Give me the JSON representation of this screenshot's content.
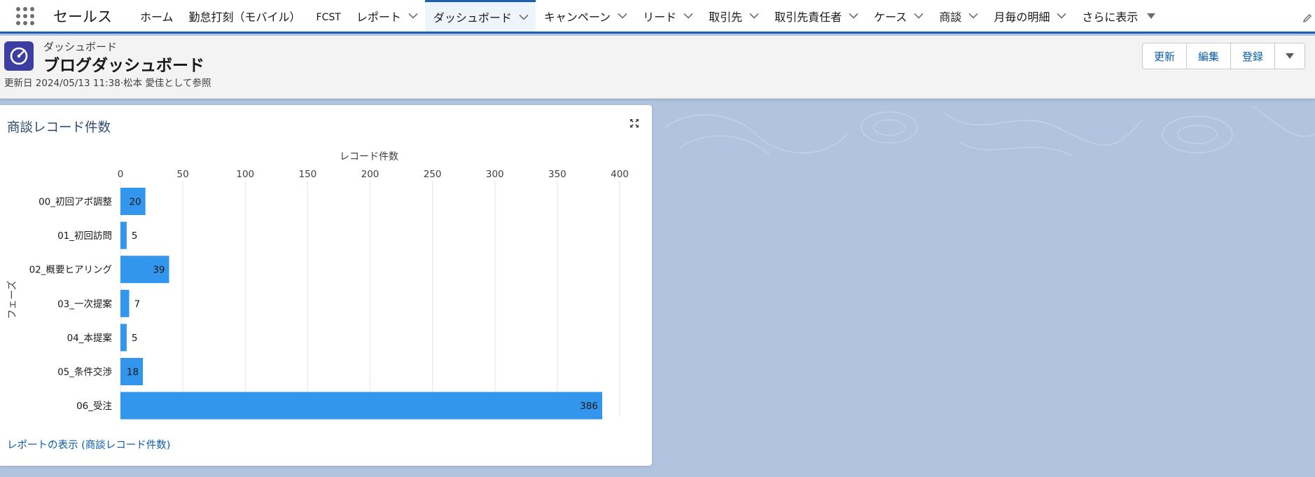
{
  "nav": {
    "app_name": "セールス",
    "items": [
      {
        "label": "ホーム",
        "dropdown": false
      },
      {
        "label": "勤怠打刻（モバイル）",
        "dropdown": false
      },
      {
        "label": "FCST",
        "dropdown": false
      },
      {
        "label": "レポート",
        "dropdown": true
      },
      {
        "label": "ダッシュボード",
        "dropdown": true,
        "active": true
      },
      {
        "label": "キャンペーン",
        "dropdown": true
      },
      {
        "label": "リード",
        "dropdown": true
      },
      {
        "label": "取引先",
        "dropdown": true
      },
      {
        "label": "取引先責任者",
        "dropdown": true
      },
      {
        "label": "ケース",
        "dropdown": true
      },
      {
        "label": "商談",
        "dropdown": true
      },
      {
        "label": "月毎の明細",
        "dropdown": true
      }
    ],
    "more_label": "さらに表示"
  },
  "header": {
    "eyebrow": "ダッシュボード",
    "title": "ブログダッシュボード",
    "meta": "更新日 2024/05/13 11:38·松本 愛佳として参照",
    "buttons": {
      "refresh": "更新",
      "edit": "編集",
      "subscribe": "登録"
    }
  },
  "card": {
    "title": "商談レコード件数",
    "report_link": "レポートの表示 (商談レコード件数)"
  },
  "colors": {
    "bar": "#3296ed",
    "brand": "#1b5fb0",
    "icon_bg": "#3c3fa1"
  },
  "chart_data": {
    "type": "bar",
    "orientation": "horizontal",
    "xlabel": "レコード件数",
    "ylabel": "フェーズ",
    "xlim": [
      0,
      400
    ],
    "ticks": [
      0,
      50,
      100,
      150,
      200,
      250,
      300,
      350,
      400
    ],
    "categories": [
      "00_初回アポ調整",
      "01_初回訪問",
      "02_概要ヒアリング",
      "03_一次提案",
      "04_本提案",
      "05_条件交渉",
      "06_受注"
    ],
    "values": [
      20,
      5,
      39,
      7,
      5,
      18,
      386
    ],
    "grid": true
  }
}
